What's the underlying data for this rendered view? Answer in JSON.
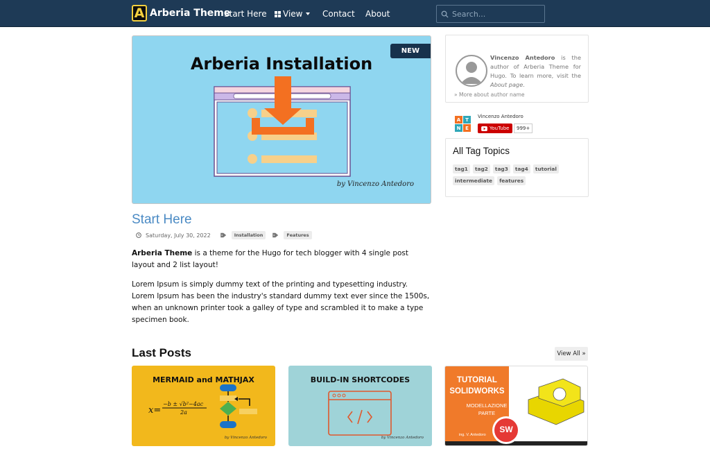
{
  "navbar": {
    "brand_letter": "A",
    "brand_name": "Arberia Theme",
    "links": {
      "start_here": "Start Here",
      "view": "View",
      "contact": "Contact",
      "about": "About"
    },
    "search_placeholder": "Search..."
  },
  "hero": {
    "image_title": "Arberia Installation",
    "badge": "NEW",
    "signature": "by Vincenzo Antedoro"
  },
  "post": {
    "title": "Start Here",
    "date": "Saturday, July 30, 2022",
    "tags": [
      "Installation",
      "Features"
    ],
    "intro_bold": "Arberia Theme",
    "intro_rest": " is a theme for the Hugo for tech blogger with 4 single post layout and 2 list layout!",
    "paragraph": "Lorem Ipsum is simply dummy text of the printing and typesetting industry. Lorem Ipsum has been the industry's standard dummy text ever since the 1500s, when an unknown printer took a galley of type and scrambled it to make a type specimen book."
  },
  "author": {
    "name": "Vincenzo Antedoro",
    "text_mid": " is the author of Arberia Theme for Hugo. To learn more, visit the ",
    "about_link": "About page",
    "text_end": ".",
    "more_link": "» More about author name"
  },
  "youtube": {
    "channel": "Vincenzo Antedoro",
    "button": "YouTube",
    "count": "999+",
    "logo_letters": [
      "A",
      "T",
      "N",
      "E"
    ]
  },
  "tags_widget": {
    "title": "All Tag Topics",
    "tags": [
      "tag1",
      "tag2",
      "tag3",
      "tag4",
      "tutorial",
      "intermediate",
      "features"
    ]
  },
  "last_posts": {
    "title": "Last Posts",
    "view_all": "View All »",
    "cards": [
      {
        "title": "MERMAID and MATHJAX",
        "signature": "by Vincenzo Antedoro"
      },
      {
        "title": "BUILD-IN SHORTCODES",
        "signature": "by Vincenzo Antedoro"
      },
      {
        "title_line1": "TUTORIAL",
        "title_line2": "SOLIDWORKS",
        "subtitle_line1": "MODELLAZIONE",
        "subtitle_line2": "PARTE",
        "author": "ing. V. Antedoro",
        "badge": "SW"
      }
    ]
  },
  "colors": {
    "navbar_bg": "#1e3a56",
    "link_blue": "#4a8ac4",
    "hero_bg": "#8fd6f0",
    "download_orange": "#f37021",
    "card1_bg": "#f2b81c",
    "card2_bg": "#9fd3d8",
    "card3_orange": "#f07a2a"
  }
}
